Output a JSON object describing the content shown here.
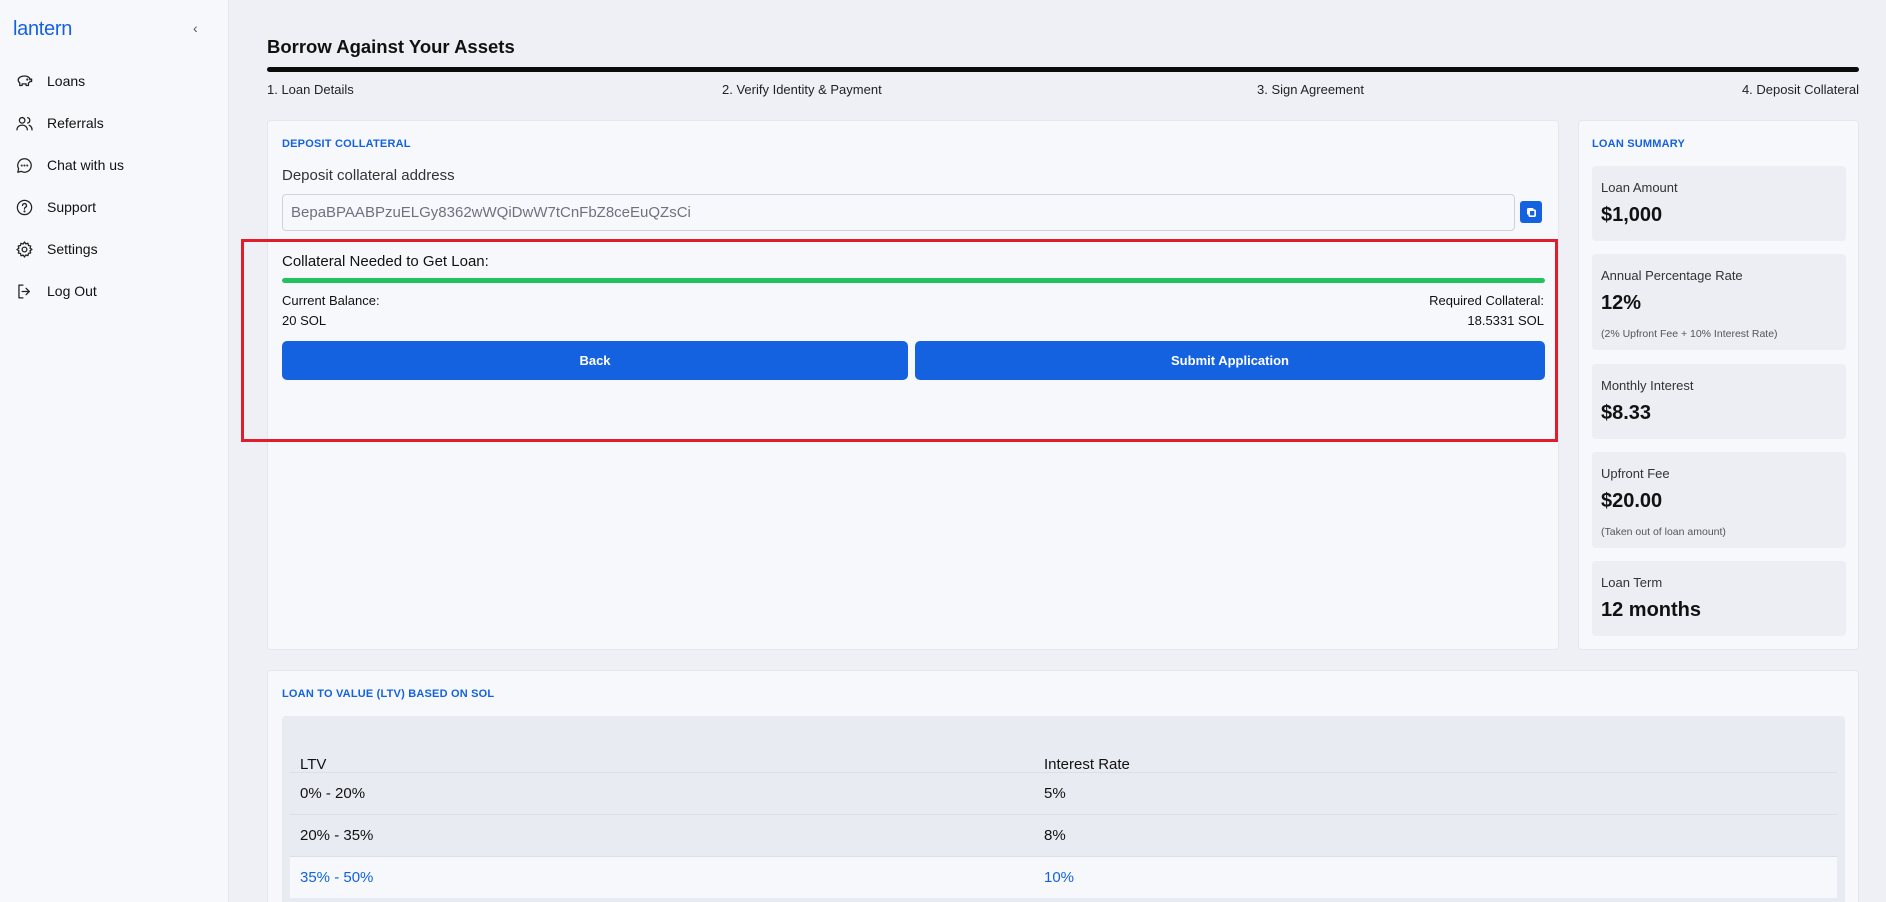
{
  "app": {
    "logo": "lantern"
  },
  "sidebar": {
    "collapse_glyph": "‹",
    "items": [
      {
        "label": "Loans",
        "icon": "piggy-bank-icon"
      },
      {
        "label": "Referrals",
        "icon": "users-icon"
      },
      {
        "label": "Chat with us",
        "icon": "chat-icon"
      },
      {
        "label": "Support",
        "icon": "help-circle-icon"
      },
      {
        "label": "Settings",
        "icon": "gear-icon"
      },
      {
        "label": "Log Out",
        "icon": "logout-icon"
      }
    ]
  },
  "page": {
    "title": "Borrow Against Your Assets"
  },
  "steps": [
    "1. Loan Details",
    "2. Verify Identity & Payment",
    "3. Sign Agreement",
    "4. Deposit Collateral"
  ],
  "deposit": {
    "section_label": "DEPOSIT COLLATERAL",
    "address_label": "Deposit collateral address",
    "address_value": "BepaBPAABPzuELGy8362wWQiDwW7tCnFbZ8ceEuQZsCi",
    "collateral_title": "Collateral Needed to Get Loan:",
    "progress_fraction": 1.0,
    "current_balance_label": "Current Balance:",
    "current_balance_value": "20 SOL",
    "required_label": "Required Collateral:",
    "required_value": "18.5331 SOL",
    "back_label": "Back",
    "submit_label": "Submit Application"
  },
  "summary": {
    "section_label": "LOAN SUMMARY",
    "tiles": [
      {
        "label": "Loan Amount",
        "value": "$1,000",
        "note": ""
      },
      {
        "label": "Annual Percentage Rate",
        "value": "12%",
        "note": "(2% Upfront Fee + 10% Interest Rate)"
      },
      {
        "label": "Monthly Interest",
        "value": "$8.33",
        "note": ""
      },
      {
        "label": "Upfront Fee",
        "value": "$20.00",
        "note": "(Taken out of loan amount)"
      },
      {
        "label": "Loan Term",
        "value": "12 months",
        "note": ""
      }
    ]
  },
  "ltv": {
    "section_label": "LOAN TO VALUE (LTV) BASED ON SOL",
    "headers": [
      "LTV",
      "Interest Rate"
    ],
    "rows": [
      {
        "ltv": "0% - 20%",
        "rate": "5%"
      },
      {
        "ltv": "20% - 35%",
        "rate": "8%"
      },
      {
        "ltv": "35% - 50%",
        "rate": "10%"
      }
    ]
  },
  "colors": {
    "accent": "#1462e0",
    "progress": "#22c35e",
    "highlight": "#e01e2b",
    "background": "#eff0f6"
  }
}
